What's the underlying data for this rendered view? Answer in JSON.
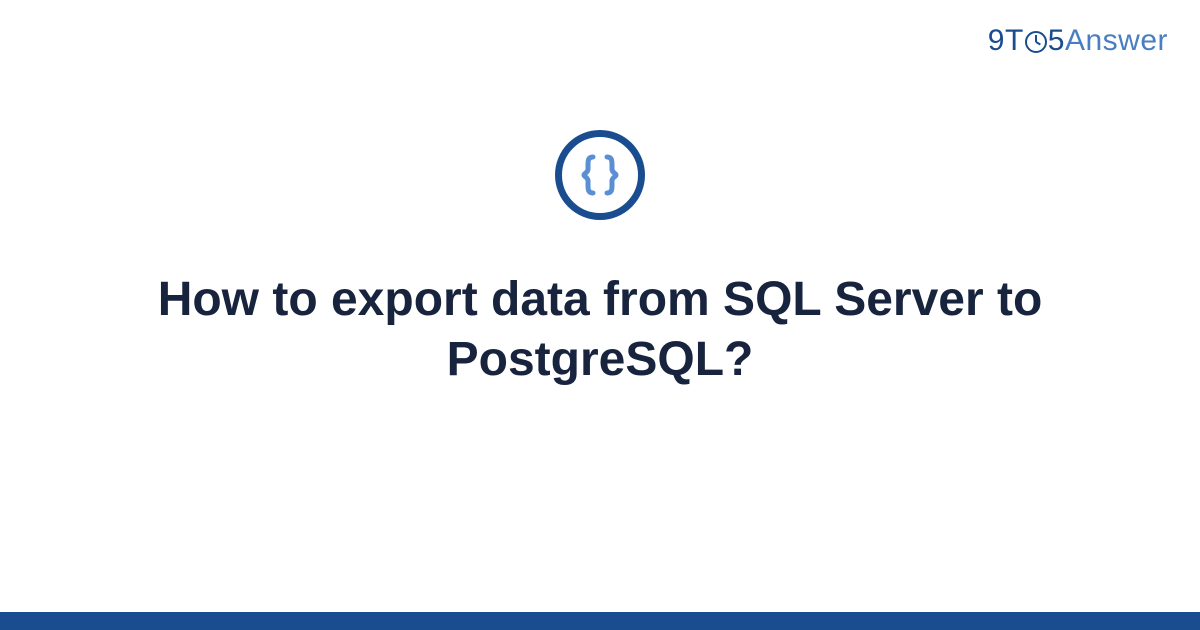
{
  "logo": {
    "part1": "9",
    "part2": "T",
    "part3": "5",
    "part4": "Answer"
  },
  "icon": {
    "name": "curly-braces-icon"
  },
  "title": "How to export data from SQL Server to PostgreSQL?",
  "colors": {
    "primary": "#1a4d8f",
    "secondary": "#4a7ec2",
    "text": "#18233d"
  }
}
